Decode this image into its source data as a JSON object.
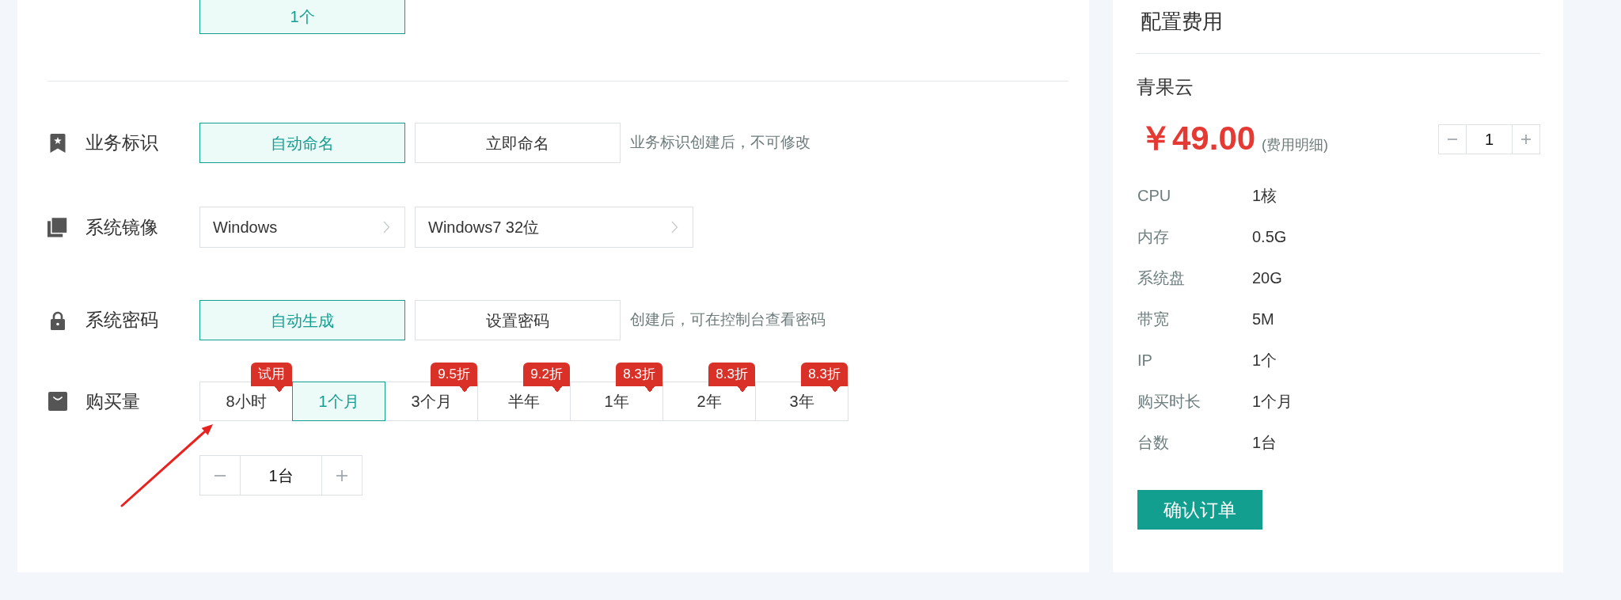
{
  "form": {
    "top_option": {
      "label": "1个",
      "selected": true
    },
    "rows": [
      {
        "kind": "choice",
        "label": "业务标识",
        "options": [
          {
            "label": "自动命名",
            "selected": true
          },
          {
            "label": "立即命名",
            "selected": false
          }
        ],
        "hint": "业务标识创建后，不可修改"
      },
      {
        "kind": "select",
        "label": "系统镜像",
        "selects": [
          {
            "value": "Windows"
          },
          {
            "value": "Windows7 32位"
          }
        ]
      },
      {
        "kind": "choice",
        "label": "系统密码",
        "options": [
          {
            "label": "自动生成",
            "selected": true
          },
          {
            "label": "设置密码",
            "selected": false
          }
        ],
        "hint": "创建后，可在控制台查看密码"
      },
      {
        "kind": "tabs",
        "label": "购买量",
        "options": [
          {
            "label": "8小时",
            "badge": "试用",
            "selected": false
          },
          {
            "label": "1个月",
            "selected": true
          },
          {
            "label": "3个月",
            "badge": "9.5折",
            "selected": false
          },
          {
            "label": "半年",
            "badge": "9.2折",
            "selected": false
          },
          {
            "label": "1年",
            "badge": "8.3折",
            "selected": false
          },
          {
            "label": "2年",
            "badge": "8.3折",
            "selected": false
          },
          {
            "label": "3年",
            "badge": "8.3折",
            "selected": false
          }
        ]
      }
    ],
    "quantity": {
      "value": "1台"
    },
    "annotation": {
      "kind": "arrow"
    }
  },
  "summary": {
    "title": "配置费用",
    "product": "青果云",
    "price": "￥49.00",
    "detail": {
      "open": "(",
      "link": "费用明细",
      "close": ")"
    },
    "quantity": {
      "value": "1"
    },
    "specs": [
      {
        "label": "CPU",
        "value": "1核"
      },
      {
        "label": "内存",
        "value": "0.5G"
      },
      {
        "label": "系统盘",
        "value": "20G"
      },
      {
        "label": "带宽",
        "value": "5M"
      },
      {
        "label": "IP",
        "value": "1个"
      },
      {
        "label": "购买时长",
        "value": "1个月"
      },
      {
        "label": "台数",
        "value": "1台"
      }
    ],
    "confirm_button": "确认订单"
  }
}
